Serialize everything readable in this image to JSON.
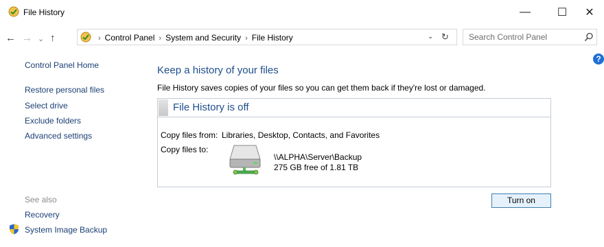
{
  "window": {
    "title": "File History",
    "min_glyph": "—",
    "max_glyph": "☐",
    "close_glyph": "✕"
  },
  "nav": {
    "back": "←",
    "forward": "→",
    "recent": "⌄",
    "up": "↑"
  },
  "breadcrumb": {
    "items": [
      "Control Panel",
      "System and Security",
      "File History"
    ],
    "separator": "›",
    "dropdown": "⌄",
    "refresh": "↻"
  },
  "search": {
    "placeholder": "Search Control Panel"
  },
  "help": {
    "glyph": "?"
  },
  "sidebar": {
    "home": "Control Panel Home",
    "items": [
      "Restore personal files",
      "Select drive",
      "Exclude folders",
      "Advanced settings"
    ],
    "see_also_title": "See also",
    "see_also": [
      "Recovery",
      "System Image Backup"
    ]
  },
  "main": {
    "title": "Keep a history of your files",
    "description": "File History saves copies of your files so you can get them back if they're lost or damaged.",
    "status": "File History is off",
    "copy_from_label": "Copy files from:",
    "copy_from_value": "Libraries, Desktop, Contacts, and Favorites",
    "copy_to_label": "Copy files to:",
    "drive_path": "\\\\ALPHA\\Server\\Backup",
    "drive_space": "275 GB free of 1.81 TB",
    "turn_on_label": "Turn on"
  },
  "colors": {
    "link": "#1a3f74",
    "heading": "#1e4e8c",
    "accent": "#3c7fb1"
  }
}
